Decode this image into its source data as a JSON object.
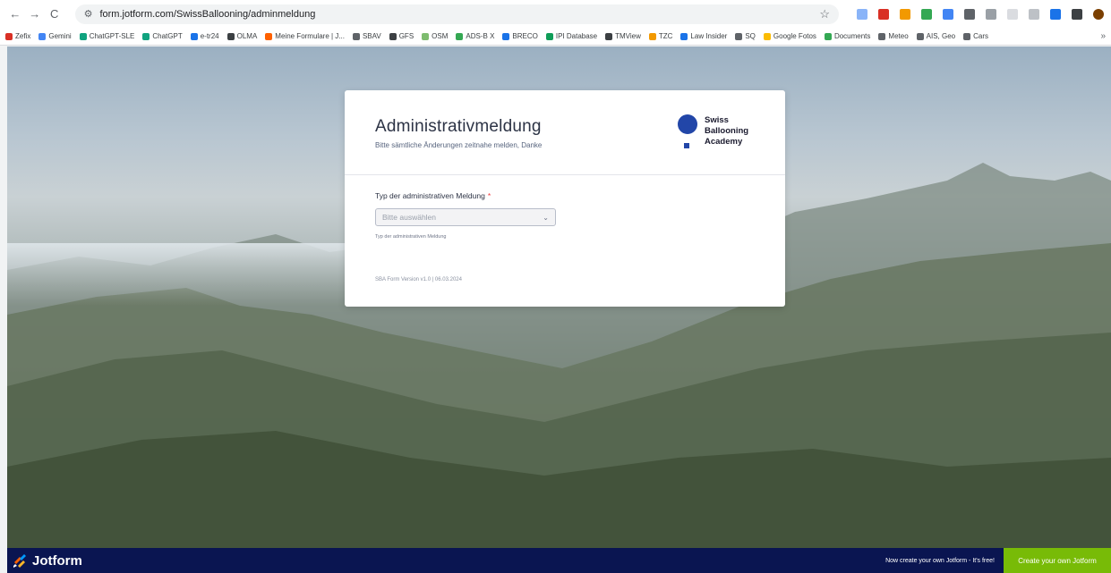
{
  "browser": {
    "url": "form.jotform.com/SwissBallooning/adminmeldung",
    "back": "←",
    "forward": "→",
    "reload": "C",
    "tune": "⚙",
    "star": "☆",
    "more": "»",
    "bookmarks": [
      {
        "label": "Zefix",
        "color": "#d93025"
      },
      {
        "label": "Gemini",
        "color": "#4285f4"
      },
      {
        "label": "ChatGPT-SLE",
        "color": "#10a37f"
      },
      {
        "label": "ChatGPT",
        "color": "#10a37f"
      },
      {
        "label": "e-tr24",
        "color": "#1a73e8"
      },
      {
        "label": "OLMA",
        "color": "#3c4043"
      },
      {
        "label": "Meine Formulare | J...",
        "color": "#ff6100"
      },
      {
        "label": "SBAV",
        "color": "#5f6368"
      },
      {
        "label": "GFS",
        "color": "#3c4043"
      },
      {
        "label": "OSM",
        "color": "#7ebc6f"
      },
      {
        "label": "ADS-B X",
        "color": "#34a853"
      },
      {
        "label": "BRECO",
        "color": "#1a73e8"
      },
      {
        "label": "IPI Database",
        "color": "#0f9d58"
      },
      {
        "label": "TMView",
        "color": "#3c4043"
      },
      {
        "label": "TZC",
        "color": "#f29900"
      },
      {
        "label": "Law Insider",
        "color": "#1a73e8"
      },
      {
        "label": "SQ",
        "color": "#5f6368"
      },
      {
        "label": "Google Fotos",
        "color": "#fbbc04"
      },
      {
        "label": "Documents",
        "color": "#34a853"
      },
      {
        "label": "Meteo",
        "color": "#5f6368"
      },
      {
        "label": "AIS, Geo",
        "color": "#5f6368"
      },
      {
        "label": "Cars",
        "color": "#5f6368"
      }
    ]
  },
  "form": {
    "title": "Administrativmeldung",
    "subtitle": "Bitte sämtliche Änderungen zeitnahe melden, Danke",
    "logo_line1": "Swiss",
    "logo_line2": "Ballooning",
    "logo_line3": "Academy",
    "field_label": "Typ der administrativen Meldung",
    "required_mark": "*",
    "select_placeholder": "Bitte auswählen",
    "field_hint": "Typ der administrativen Meldung",
    "version": "SBA Form Version v1.0 | 06.03.2024"
  },
  "footer": {
    "brand": "Jotform",
    "promo_text": "Now create your own Jotform - It's free!",
    "cta_label": "Create your own Jotform"
  },
  "colors": {
    "brand_blue": "#2246a8",
    "footer_bg": "#0a1551",
    "cta_green": "#78bb07",
    "required_red": "#f23a3c"
  }
}
